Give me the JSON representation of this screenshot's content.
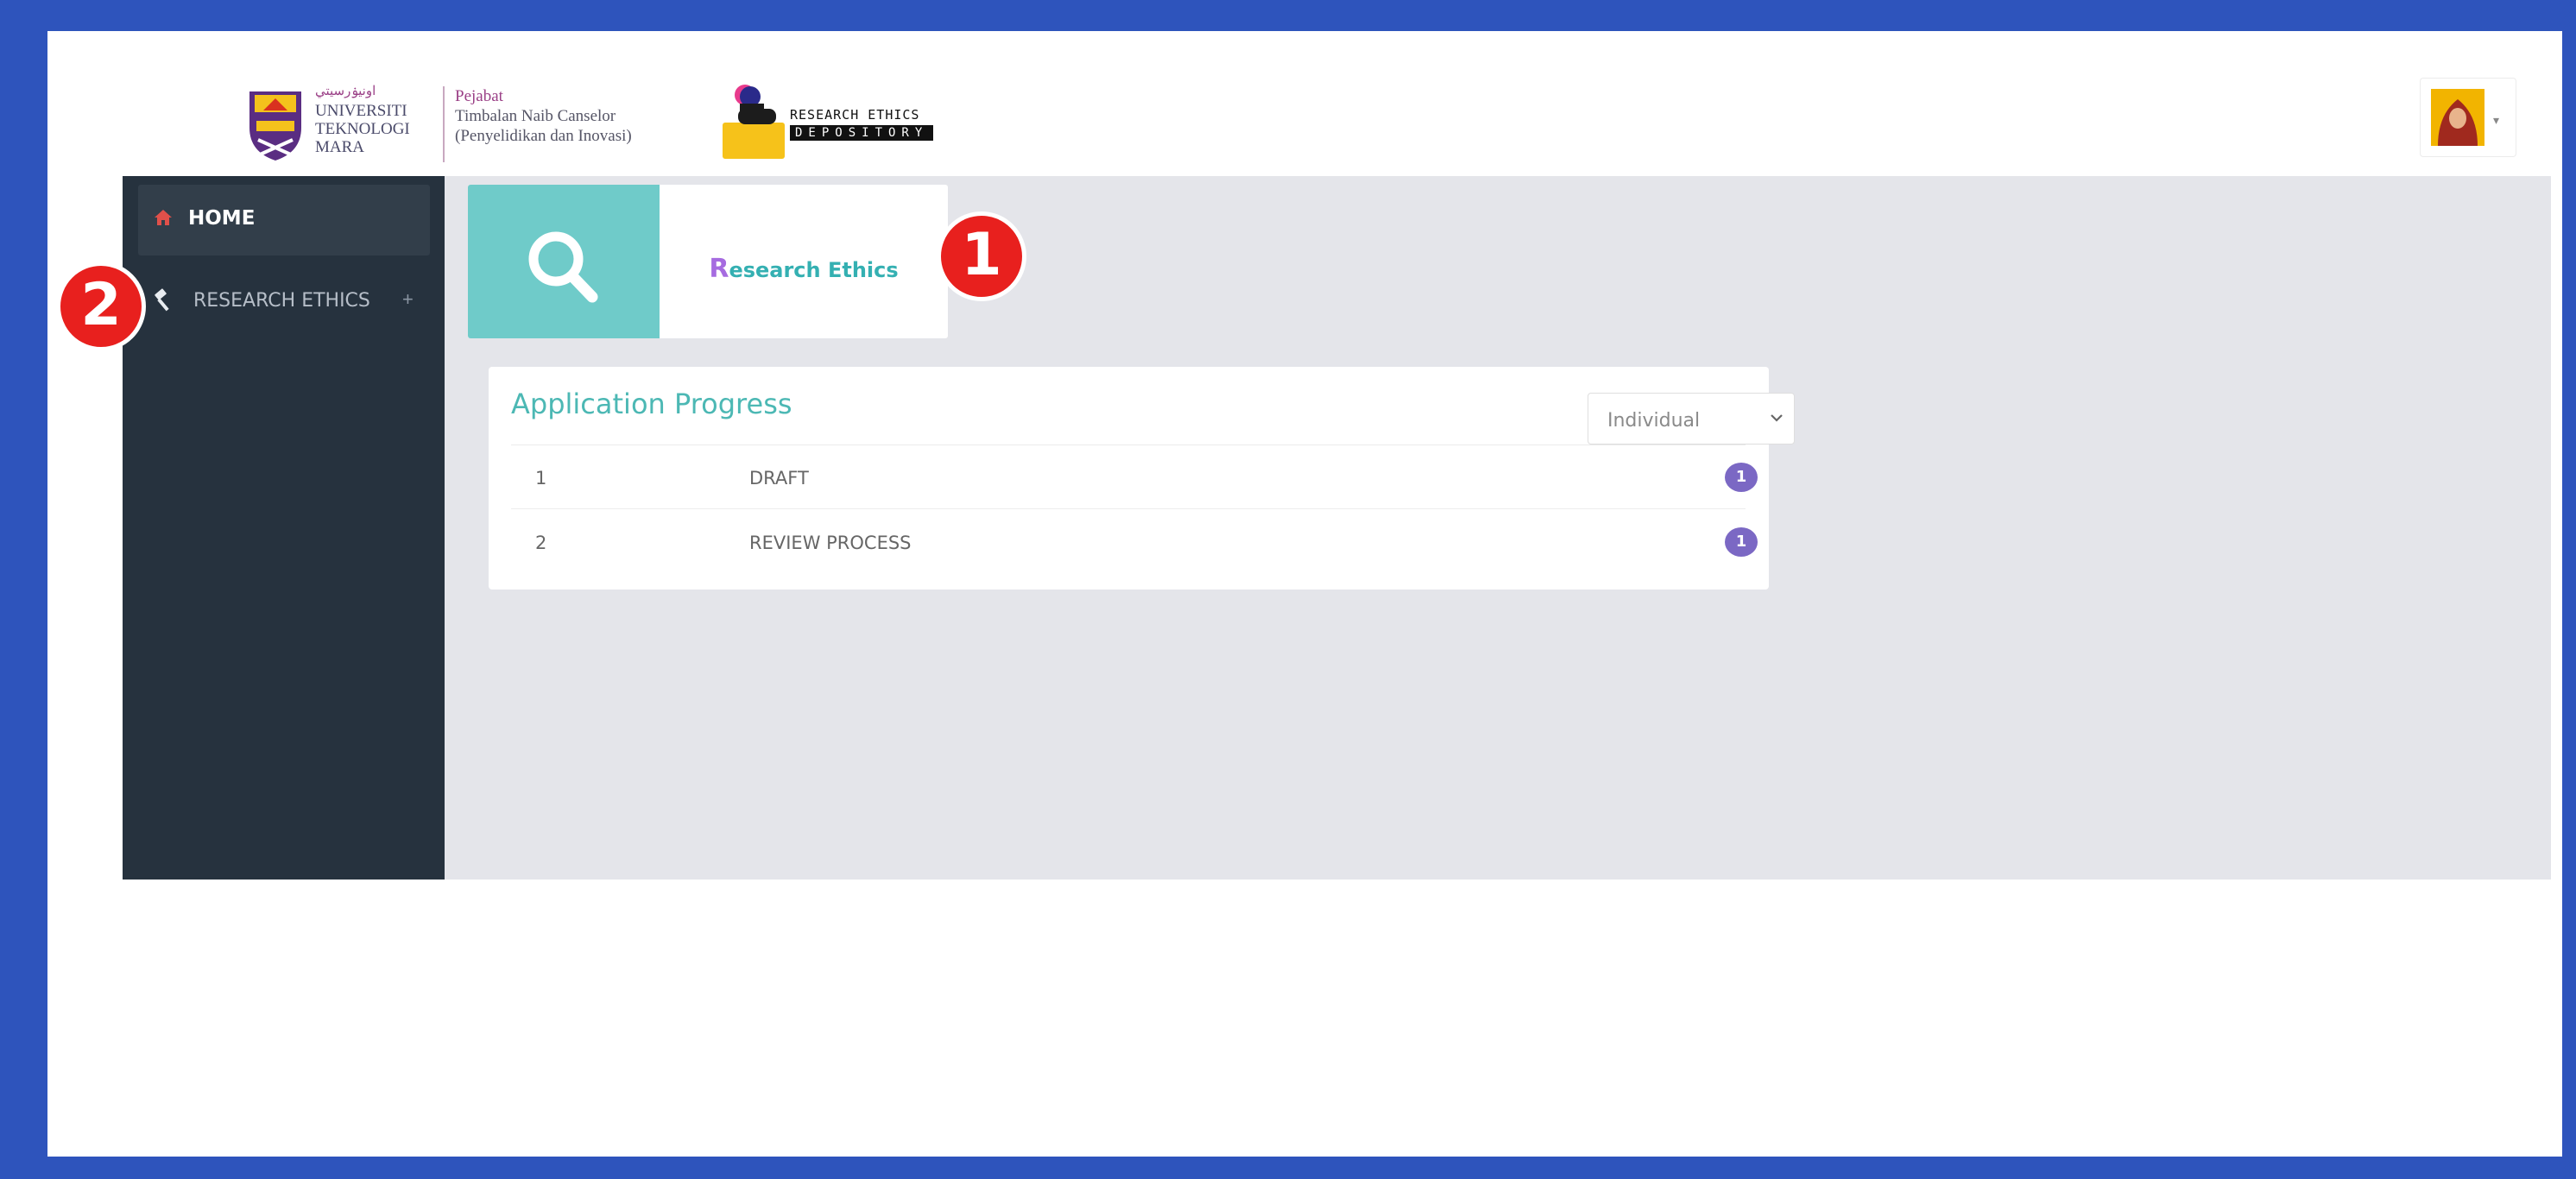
{
  "header": {
    "university": {
      "jawi": "اونيۏرسيتي",
      "line1": "UNIVERSITI",
      "line2": "TEKNOLOGI",
      "line3": "MARA"
    },
    "office": {
      "line1": "Pejabat",
      "line2": "Timbalan Naib Canselor",
      "line3": "(Penyelidikan dan Inovasi)"
    },
    "app_logo": {
      "line1": "RESEARCH ETHICS",
      "line2": "DEPOSITORY"
    },
    "user_menu": {
      "icon": "user-avatar"
    }
  },
  "sidebar": {
    "items": [
      {
        "label": "HOME",
        "icon": "home-icon",
        "active": true
      },
      {
        "label": "RESEARCH ETHICS",
        "icon": "gavel-icon",
        "expand": "+"
      }
    ]
  },
  "main": {
    "module_card": {
      "title_first": "R",
      "title_rest": "esearch Ethics",
      "icon": "search-icon",
      "tile_color": "#6fcbc9"
    },
    "progress": {
      "heading": "Application Progress",
      "filter": {
        "selected": "Individual"
      },
      "rows": [
        {
          "no": "1",
          "status": "DRAFT",
          "count": "1"
        },
        {
          "no": "2",
          "status": "REVIEW PROCESS",
          "count": "1"
        }
      ]
    }
  },
  "annotations": [
    {
      "label": "1"
    },
    {
      "label": "2"
    }
  ],
  "colors": {
    "frame": "#2e54bc",
    "sidebar": "#26323e",
    "accent_teal": "#4cb8b4",
    "badge": "#7b68c4",
    "marker": "#e8201e"
  }
}
